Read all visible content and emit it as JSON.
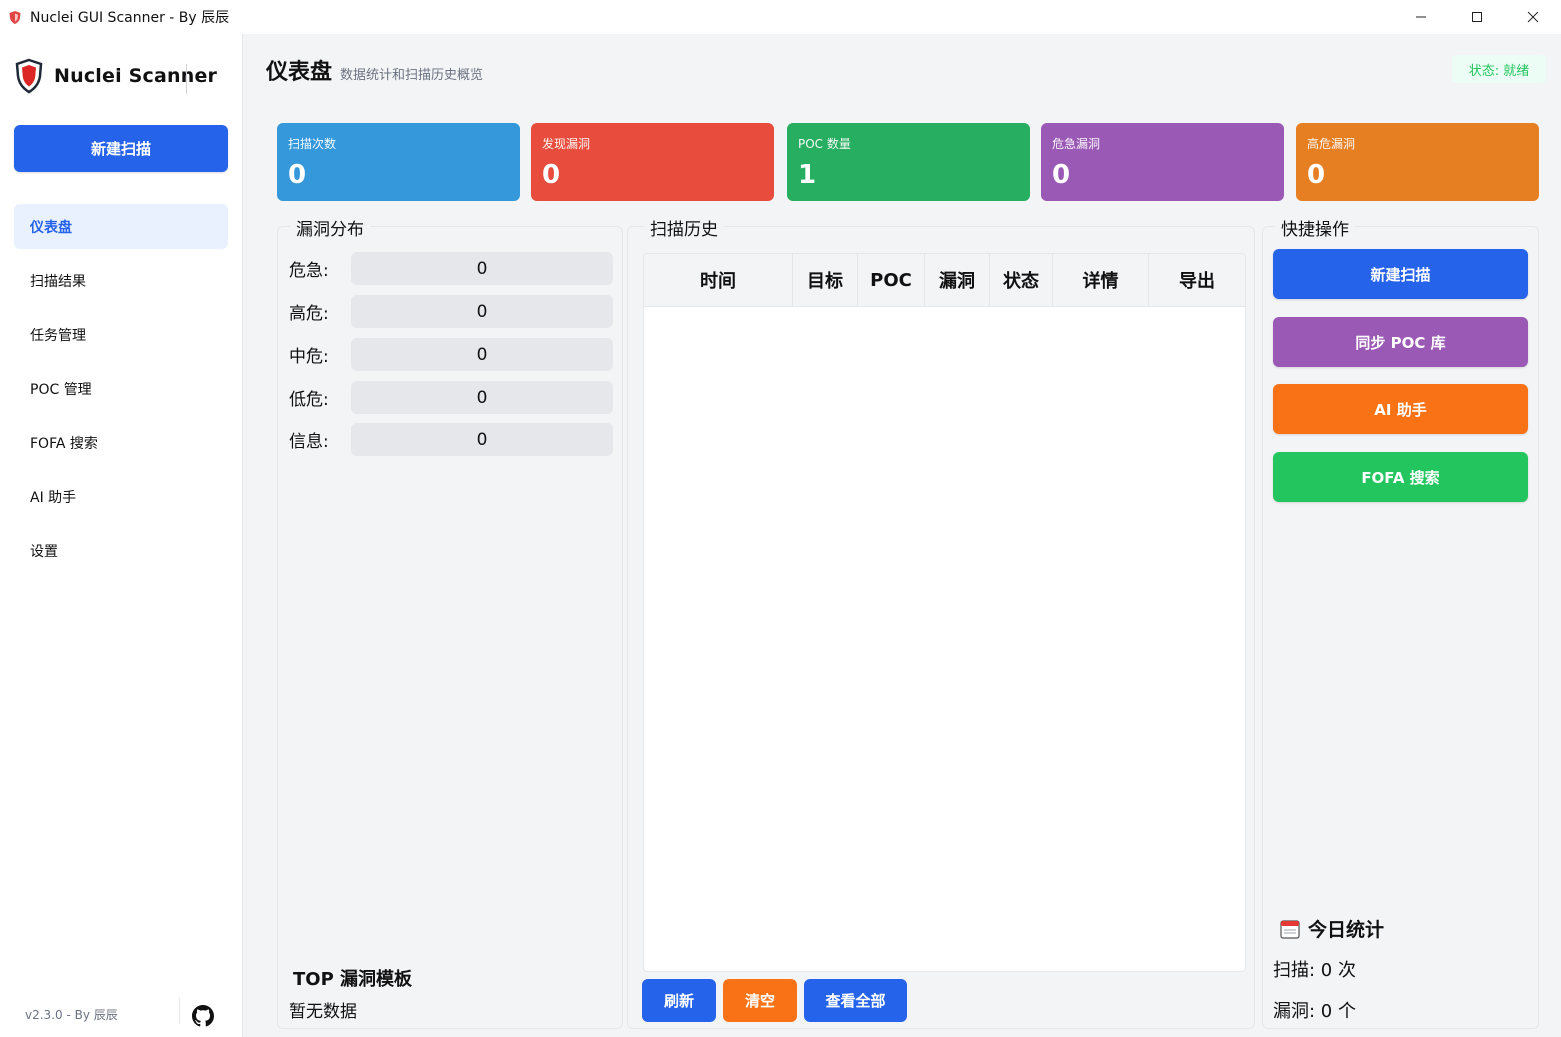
{
  "window": {
    "title": "Nuclei GUI Scanner - By 辰辰",
    "controls": [
      "minimize",
      "maximize",
      "close"
    ]
  },
  "sidebar": {
    "brand": "Nuclei Scanner",
    "new_scan": "新建扫描",
    "items": [
      {
        "label": "仪表盘",
        "active": true
      },
      {
        "label": "扫描结果"
      },
      {
        "label": "任务管理"
      },
      {
        "label": "POC 管理"
      },
      {
        "label": "FOFA 搜索"
      },
      {
        "label": "AI 助手"
      },
      {
        "label": "设置"
      }
    ],
    "version": "v2.3.0 - By 辰辰"
  },
  "header": {
    "title": "仪表盘",
    "subtitle": "数据统计和扫描历史概览",
    "status": "状态: 就绪"
  },
  "stats": [
    {
      "label": "扫描次数",
      "value": "0",
      "color": "#3498db"
    },
    {
      "label": "发现漏洞",
      "value": "0",
      "color": "#e74c3c"
    },
    {
      "label": "POC 数量",
      "value": "1",
      "color": "#27ae60"
    },
    {
      "label": "危急漏洞",
      "value": "0",
      "color": "#9b59b6"
    },
    {
      "label": "高危漏洞",
      "value": "0",
      "color": "#e67e22"
    }
  ],
  "distribution": {
    "title": "漏洞分布",
    "rows": [
      {
        "label": "危急:",
        "value": "0"
      },
      {
        "label": "高危:",
        "value": "0"
      },
      {
        "label": "中危:",
        "value": "0"
      },
      {
        "label": "低危:",
        "value": "0"
      },
      {
        "label": "信息:",
        "value": "0"
      }
    ],
    "top_title": "TOP 漏洞模板",
    "top_empty": "暂无数据"
  },
  "history": {
    "title": "扫描历史",
    "columns": [
      "时间",
      "目标",
      "POC",
      "漏洞",
      "状态",
      "详情",
      "导出"
    ],
    "rows": [],
    "buttons": {
      "refresh": "刷新",
      "clear": "清空",
      "view_all": "查看全部"
    }
  },
  "quick": {
    "title": "快捷操作",
    "buttons": [
      {
        "label": "新建扫描",
        "color": "#2563eb"
      },
      {
        "label": "同步 POC 库",
        "color": "#9b59b6"
      },
      {
        "label": "AI 助手",
        "color": "#f97316"
      },
      {
        "label": "FOFA 搜索",
        "color": "#22c55e"
      }
    ],
    "today_title": "今日统计",
    "today_scans": "扫描: 0 次",
    "today_vulns": "漏洞: 0 个"
  },
  "colors": {
    "accent": "#2563eb",
    "status_ok": "#22c55e"
  }
}
